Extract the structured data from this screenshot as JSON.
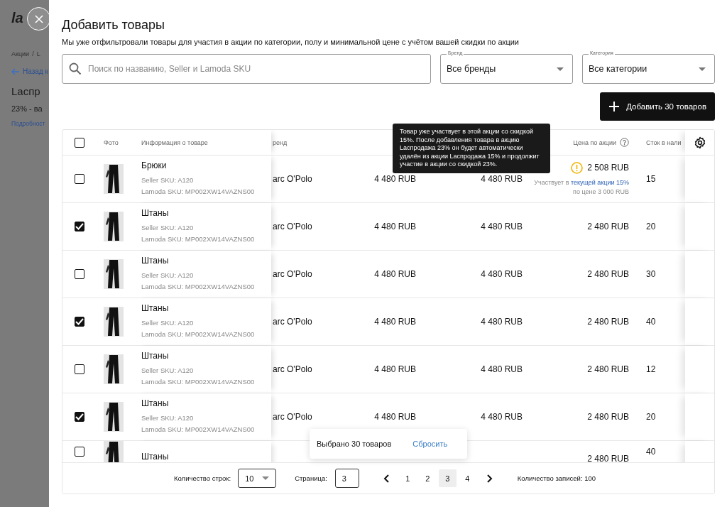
{
  "backdrop": {
    "logo": "la",
    "breadcrumb": [
      "Акции",
      "/",
      "L"
    ],
    "back_link": "Назад к",
    "title": "Lacпр",
    "subtitle": "23% - ва",
    "details_link": "Подробност"
  },
  "modal": {
    "title": "Добавить товары",
    "subtitle": "Мы уже отфильтровали товары для участия в акции по категории, полу и минимальной цене с учётом вашей скидки по акции",
    "search": {
      "placeholder": "Поиск по названию, Seller и Lamoda SKU"
    },
    "filters": [
      {
        "label": "Бренд",
        "value": "Все бренды"
      },
      {
        "label": "Категория",
        "value": "Все категории"
      }
    ],
    "add_button": "Добавить 30 товаров"
  },
  "table": {
    "select_all": {
      "checked": false
    },
    "columns": {
      "photo": "Фото",
      "info": "Информация о товаре",
      "brand": "ренд",
      "promo_price": "Цена по акции",
      "stock": "Сток в нали"
    },
    "rows": [
      {
        "checked": false,
        "name": "Брюки",
        "seller_sku": "Seller SKU: A120",
        "lamoda_sku": "Lamoda SKU: MP002XW14VAZNS00",
        "brand": "arc O'Polo",
        "price_1": "4 480 RUB",
        "price_2": "4 480 RUB",
        "promo_price": "2 508 RUB",
        "kind": "warning",
        "note": "Участвует в",
        "note_link": "текущей акции 15%",
        "note_tail": "по цене 3 000 RUB",
        "stock": "15"
      },
      {
        "checked": true,
        "name": "Штаны",
        "seller_sku": "Seller SKU: A120",
        "lamoda_sku": "Lamoda SKU: MP002XW14VAZNS00",
        "brand": "arc O'Polo",
        "price_1": "4 480 RUB",
        "price_2": "4 480 RUB",
        "promo_price": "2 480 RUB",
        "kind": "normal",
        "stock": "20"
      },
      {
        "checked": false,
        "name": "Штаны",
        "seller_sku": "Seller SKU: A120",
        "lamoda_sku": "Lamoda SKU: MP002XW14VAZNS00",
        "brand": "arc O'Polo",
        "price_1": "4 480 RUB",
        "price_2": "4 480 RUB",
        "promo_price": "2 480 RUB",
        "kind": "normal",
        "stock": "30"
      },
      {
        "checked": true,
        "name": "Штаны",
        "seller_sku": "Seller SKU: A120",
        "lamoda_sku": "Lamoda SKU: MP002XW14VAZNS00",
        "brand": "arc O'Polo",
        "price_1": "4 480 RUB",
        "price_2": "4 480 RUB",
        "promo_price": "2 480 RUB",
        "kind": "normal",
        "stock": "40"
      },
      {
        "checked": false,
        "name": "Штаны",
        "seller_sku": "Seller SKU: A120",
        "lamoda_sku": "Lamoda SKU: MP002XW14VAZNS00",
        "brand": "arc O'Polo",
        "price_1": "4 480 RUB",
        "price_2": "4 480 RUB",
        "promo_price": "2 480 RUB",
        "kind": "normal",
        "stock": "12"
      },
      {
        "checked": true,
        "name": "Штаны",
        "seller_sku": "Seller SKU: A120",
        "lamoda_sku": "Lamoda SKU: MP002XW14VAZNS00",
        "brand": "arc O'Polo",
        "price_1": "4 480 RUB",
        "price_2": "4 480 RUB",
        "promo_price": "2 480 RUB",
        "kind": "normal",
        "stock": "20"
      },
      {
        "checked": false,
        "name": "Штаны",
        "promo_price": "2 480 RUB",
        "kind": "normal",
        "stock": "40"
      }
    ],
    "tooltip": "Товар уже участвует в этой акции со скидкой 15%. После добавления товара в акцию Lacпродажа 23% он будет автоматически удалён из акции Lacпродажа 15% и продолжит участие в акции со скидкой 23%.",
    "selection": {
      "text": "Выбрано 30 товаров",
      "reset": "Сбросить"
    },
    "pagination": {
      "rows_label": "Количество строк:",
      "rows_value": "10",
      "page_label": "Страница:",
      "page_value": "3",
      "pages": [
        {
          "label": "1",
          "selected": false
        },
        {
          "label": "2",
          "selected": false
        },
        {
          "label": "3",
          "selected": true
        },
        {
          "label": "4",
          "selected": false
        }
      ],
      "total": "Количество записей: 100"
    }
  }
}
